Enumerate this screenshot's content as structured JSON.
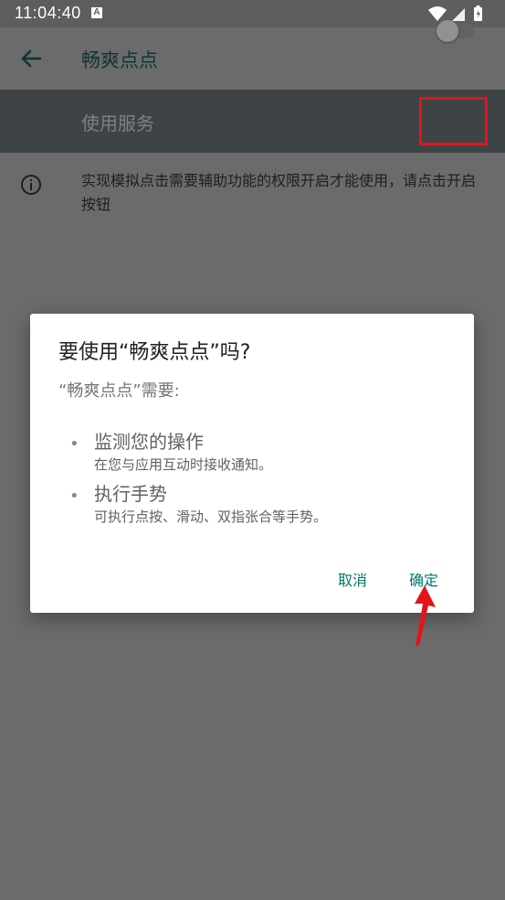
{
  "status_bar": {
    "time": "11:04:40",
    "notification_icon": "A",
    "icons": [
      "wifi-icon",
      "signal-icon",
      "battery-icon"
    ]
  },
  "app_bar": {
    "back_icon": "arrow-left-icon",
    "title": "畅爽点点"
  },
  "service": {
    "label": "使用服务",
    "toggle_on": false
  },
  "info": {
    "icon": "info-icon",
    "text": "实现模拟点击需要辅助功能的权限开启才能使用，请点击开启按钮"
  },
  "dialog": {
    "title": "要使用“畅爽点点”吗?",
    "subtitle": "“畅爽点点”需要:",
    "permissions": [
      {
        "title": "监测您的操作",
        "desc": "在您与应用互动时接收通知。"
      },
      {
        "title": "执行手势",
        "desc": "可执行点按、滑动、双指张合等手势。"
      }
    ],
    "cancel_label": "取消",
    "ok_label": "确定"
  },
  "colors": {
    "accent": "#00796b",
    "highlight": "#e3141a",
    "scrim": "#6b6b6b"
  }
}
